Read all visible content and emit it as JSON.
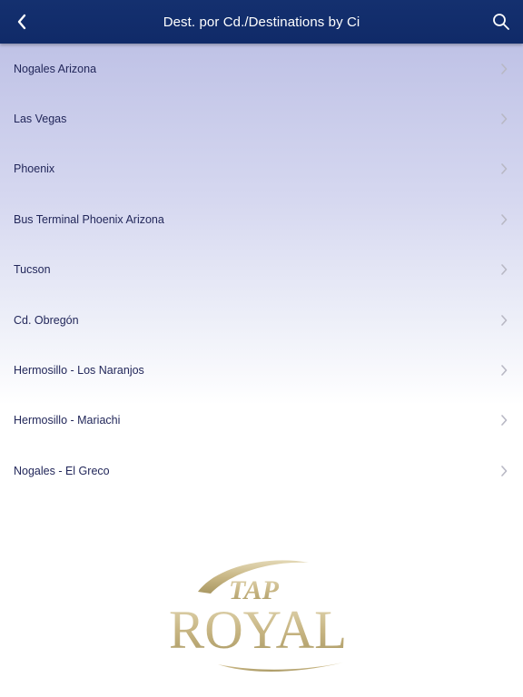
{
  "header": {
    "title": "Dest. por Cd./Destinations by Ci",
    "back_icon": "chevron-left-icon",
    "search_icon": "search-icon"
  },
  "destinations": [
    {
      "label": "Nogales Arizona"
    },
    {
      "label": "Las Vegas"
    },
    {
      "label": "Phoenix"
    },
    {
      "label": "Bus Terminal Phoenix Arizona"
    },
    {
      "label": "Tucson"
    },
    {
      "label": "Cd. Obregón"
    },
    {
      "label": "Hermosillo - Los Naranjos"
    },
    {
      "label": "Hermosillo - Mariachi"
    },
    {
      "label": "Nogales - El Greco"
    }
  ],
  "logo": {
    "text_top": "TAP",
    "text_main": "ROYAL"
  },
  "colors": {
    "header_bg": "#12306c",
    "row_text": "#22275a",
    "chevron": "#b8b8c4",
    "logo_gold": "#c9b98c"
  }
}
